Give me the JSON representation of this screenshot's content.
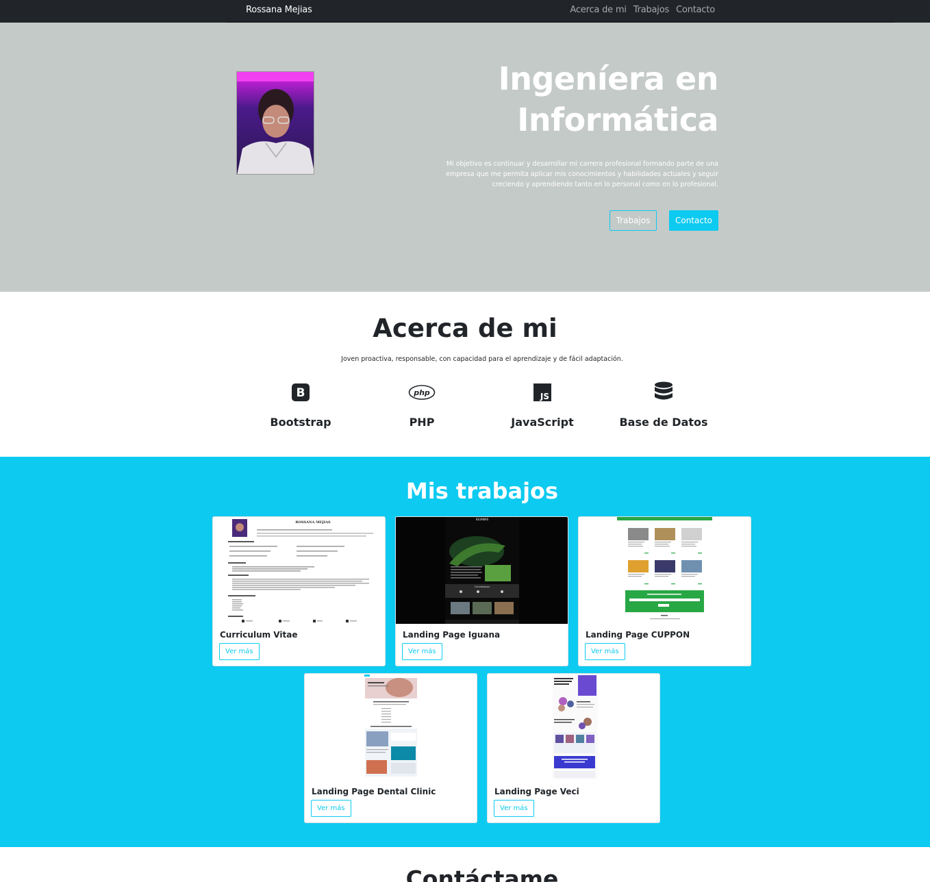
{
  "navbar": {
    "brand": "Rossana Mejias",
    "links": [
      "Acerca de mi",
      "Trabajos",
      "Contacto"
    ]
  },
  "hero": {
    "title_line1": "Ingeníera en",
    "title_line2": "Informática",
    "text": "Mi objetivo es continuar y desarrollar mi carrera profesional formando parte de una empresa que me permita aplicar mis conocimientos y habilidades actuales y seguir creciendo y aprendiendo tanto en lo personal como en lo profesional.",
    "btn_works": "Trabajos",
    "btn_contact": "Contacto"
  },
  "about": {
    "title": "Acerca de mi",
    "text": "Joven proactiva, responsable, con capacidad para el aprendizaje y de fácil adaptación.",
    "skills": [
      {
        "label": "Bootstrap",
        "icon": "bootstrap-icon"
      },
      {
        "label": "PHP",
        "icon": "php-icon"
      },
      {
        "label": "JavaScript",
        "icon": "javascript-icon"
      },
      {
        "label": "Base de Datos",
        "icon": "database-icon"
      }
    ]
  },
  "works": {
    "title": "Mis trabajos",
    "cards": [
      {
        "title": "Curriculum Vitae",
        "button": "Ver más"
      },
      {
        "title": "Landing Page Iguana",
        "button": "Ver más"
      },
      {
        "title": "Landing Page CUPPON",
        "button": "Ver más"
      },
      {
        "title": "Landing Page Dental Clinic",
        "button": "Ver más"
      },
      {
        "title": "Landing Page Veci",
        "button": "Ver más"
      }
    ],
    "thumbs": {
      "cv_name": "ROSSANA MEJIAS",
      "iguana_brand": "IGUANAS",
      "iguana_section": "Cuestiones"
    }
  },
  "contact": {
    "title": "Contáctame"
  },
  "colors": {
    "navbar": "#212529",
    "hero_bg": "#c4cac8",
    "accent": "#0dcaf0"
  }
}
